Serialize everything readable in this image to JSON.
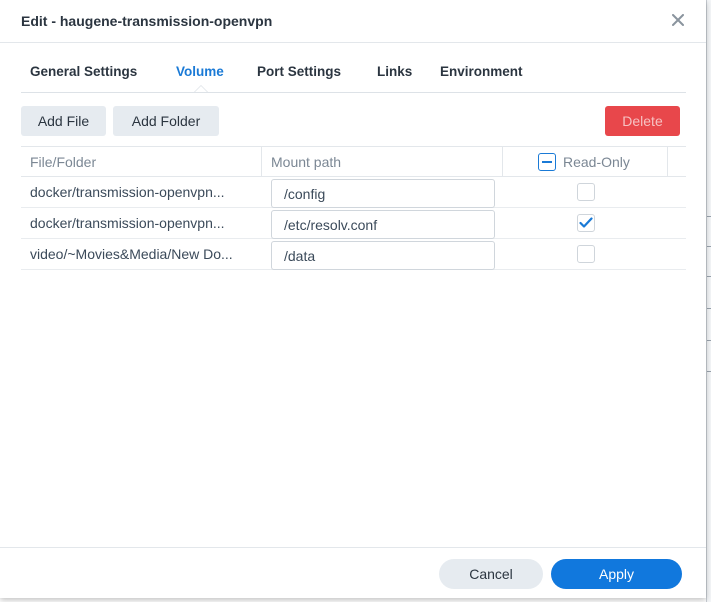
{
  "dialog": {
    "title": "Edit - haugene-transmission-openvpn"
  },
  "tabs": [
    {
      "label": "General Settings",
      "active": false
    },
    {
      "label": "Volume",
      "active": true
    },
    {
      "label": "Port Settings",
      "active": false
    },
    {
      "label": "Links",
      "active": false
    },
    {
      "label": "Environment",
      "active": false
    }
  ],
  "toolbar": {
    "add_file_label": "Add File",
    "add_folder_label": "Add Folder",
    "delete_label": "Delete"
  },
  "table": {
    "columns": [
      "File/Folder",
      "Mount path",
      "Read-Only"
    ],
    "header_checkbox_state": "indeterminate",
    "rows": [
      {
        "file_folder": "docker/transmission-openvpn...",
        "mount_path": "/config",
        "read_only": false
      },
      {
        "file_folder": "docker/transmission-openvpn...",
        "mount_path": "/etc/resolv.conf",
        "read_only": true
      },
      {
        "file_folder": "video/~Movies&Media/New Do...",
        "mount_path": "/data",
        "read_only": false
      }
    ]
  },
  "footer": {
    "cancel_label": "Cancel",
    "apply_label": "Apply"
  },
  "colors": {
    "accent": "#1178dd",
    "delete": "#e8474b",
    "button_gray": "#e6ebf0"
  }
}
